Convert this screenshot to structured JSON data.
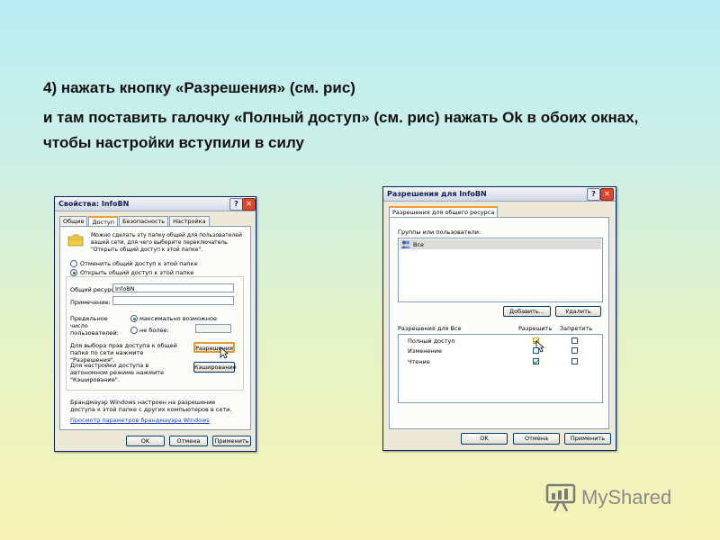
{
  "slide": {
    "line1": "4)  нажать кнопку «Разрешения» (см. рис)",
    "line2": "и там поставить галочку «Полный доступ» (см. рис) нажать Ok в обоих окнах, чтобы настройки вступили в силу"
  },
  "dialog1": {
    "title": "Свойства: InfoBN",
    "help": "?",
    "close": "✕",
    "tabs": [
      "Общие",
      "Доступ",
      "Безопасность",
      "Настройка"
    ],
    "intro": "Можно сделать эту папку общей для пользователей вашей сети, для чего выберите переключатель \"Открыть общий доступ к этой папке\".",
    "radio_off": "Отменить общий доступ к этой папке",
    "radio_on": "Открыть общий доступ к этой папке",
    "share_label": "Общий ресурс:",
    "share_value": "InfoBN",
    "comment_label": "Примечание:",
    "comment_value": "",
    "limit_label": "Предельное число пользователей:",
    "limit_max": "максимально возможное",
    "limit_nomore": "не более:",
    "perm_text": "Для выбора прав доступа к общей папке по сети нажмите \"Разрешения\".",
    "perm_button": "Разрешения",
    "cache_text": "Для настройки доступа в автономном режиме нажмите \"Кэширование\".",
    "cache_button": "Кэширование",
    "firewall_text": "Брандмауэр Windows настроен на разрешение доступа к этой папке с других компьютеров в сети.",
    "firewall_link": "Просмотр параметров брандмауэра Windows",
    "ok": "OK",
    "cancel": "Отмена",
    "apply": "Применить"
  },
  "dialog2": {
    "title": "Разрешения для InfoBN",
    "help": "?",
    "close": "✕",
    "tab": "Разрешения для общего ресурса",
    "groups_label": "Группы или пользователи:",
    "users": [
      "Все"
    ],
    "add_button": "Добавить...",
    "remove_button": "Удалить",
    "perm_header": "Разрешения для Все",
    "allow_header": "Разрешить",
    "deny_header": "Запретить",
    "permissions": [
      {
        "name": "Полный доступ",
        "allow": true,
        "deny": false
      },
      {
        "name": "Изменение",
        "allow": false,
        "deny": false
      },
      {
        "name": "Чтение",
        "allow": true,
        "deny": false
      }
    ],
    "ok": "OK",
    "cancel": "Отмена",
    "apply": "Применить"
  },
  "logo": {
    "text": "MyShared"
  },
  "colors": {
    "titlebar": "#cfd8e8",
    "close": "#d9482a",
    "check": "#21a121",
    "link": "#1a43c8"
  }
}
